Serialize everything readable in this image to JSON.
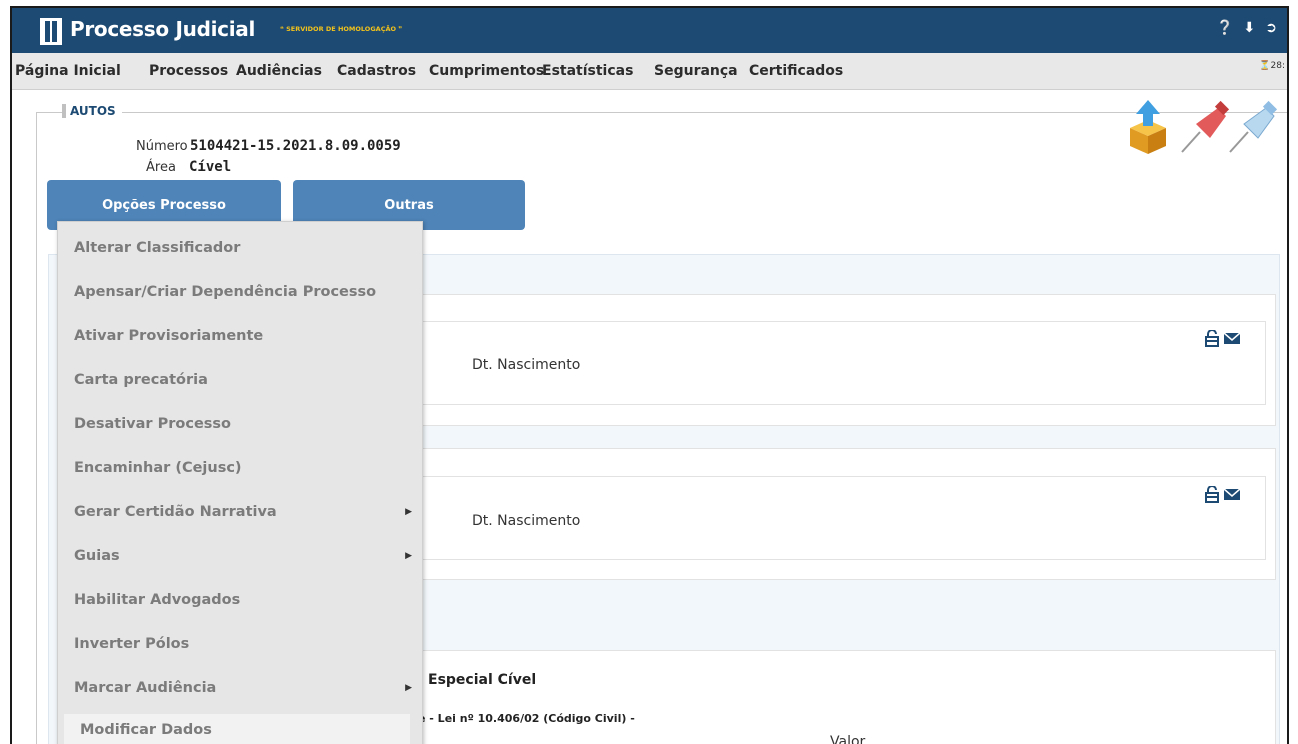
{
  "header": {
    "app_title": "Processo Judicial",
    "env_tag": "❝ SERVIDOR DE HOMOLOGAÇÃO ❞",
    "icons": [
      "help-icon",
      "download-icon",
      "logout-icon"
    ]
  },
  "nav": {
    "items": [
      "Página Inicial",
      "Processos",
      "Audiências",
      "Cadastros",
      "Cumprimentos",
      "Estatísticas",
      "Segurança",
      "Certificados"
    ],
    "session_timer": "⏳28:"
  },
  "autos": {
    "legend": "AUTOS",
    "numero_label": "Número",
    "numero_value": "5104421-15.2021.8.09.0059",
    "area_label": "Área",
    "area_value": "Cível"
  },
  "buttons": {
    "opcoes": "Opções Processo",
    "outras": "Outras"
  },
  "dropdown": {
    "items": [
      {
        "label": "Alterar Classificador",
        "submenu": false
      },
      {
        "label": "Apensar/Criar Dependência Processo",
        "submenu": false
      },
      {
        "label": "Ativar Provisoriamente",
        "submenu": false
      },
      {
        "label": "Carta precatória",
        "submenu": false
      },
      {
        "label": "Desativar Processo",
        "submenu": false
      },
      {
        "label": "Encaminhar (Cejusc)",
        "submenu": false
      },
      {
        "label": "Gerar Certidão Narrativa",
        "submenu": true
      },
      {
        "label": "Guias",
        "submenu": true
      },
      {
        "label": "Habilitar Advogados",
        "submenu": false
      },
      {
        "label": "Inverter Pólos",
        "submenu": false
      },
      {
        "label": "Marcar Audiência",
        "submenu": true
      },
      {
        "label": "Modificar Dados",
        "submenu": false
      }
    ]
  },
  "content": {
    "dt_nascimento_1": "Dt. Nascimento",
    "dt_nascimento_2": "Dt. Nascimento",
    "especial_text": "Especial Cível",
    "lei_text": "e - Lei nº 10.406/02 (Código Civil) -",
    "valor_label": "Valor"
  },
  "colors": {
    "header_bg": "#1d4a72",
    "button_bg": "#4e84b8",
    "env_tag": "#f2c21b"
  }
}
